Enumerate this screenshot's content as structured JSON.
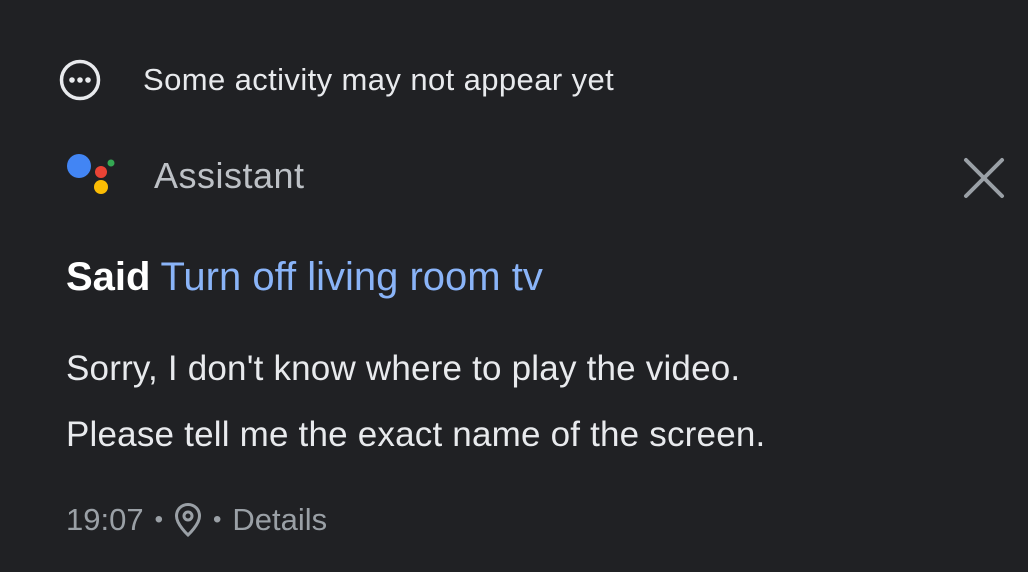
{
  "notice": {
    "icon": "more-horizontal-circle-icon",
    "text": "Some activity may not appear yet"
  },
  "header": {
    "logo": "google-assistant-icon",
    "app_name": "Assistant",
    "close_icon": "close-icon"
  },
  "activity": {
    "said_prefix": "Said",
    "query": "Turn off living room tv",
    "response_lines": [
      "Sorry, I don't know where to play the video.",
      "Please tell me the exact name of the screen."
    ]
  },
  "meta": {
    "time": "19:07",
    "separator": "•",
    "location_icon": "location-pin-icon",
    "details_label": "Details"
  },
  "colors": {
    "background": "#202124",
    "link": "#8ab4f8",
    "text": "#e8eaed",
    "secondary": "#9aa0a6",
    "assistant_blue": "#4285f4",
    "assistant_red": "#ea4335",
    "assistant_yellow": "#fbbc04",
    "assistant_green": "#34a853"
  }
}
